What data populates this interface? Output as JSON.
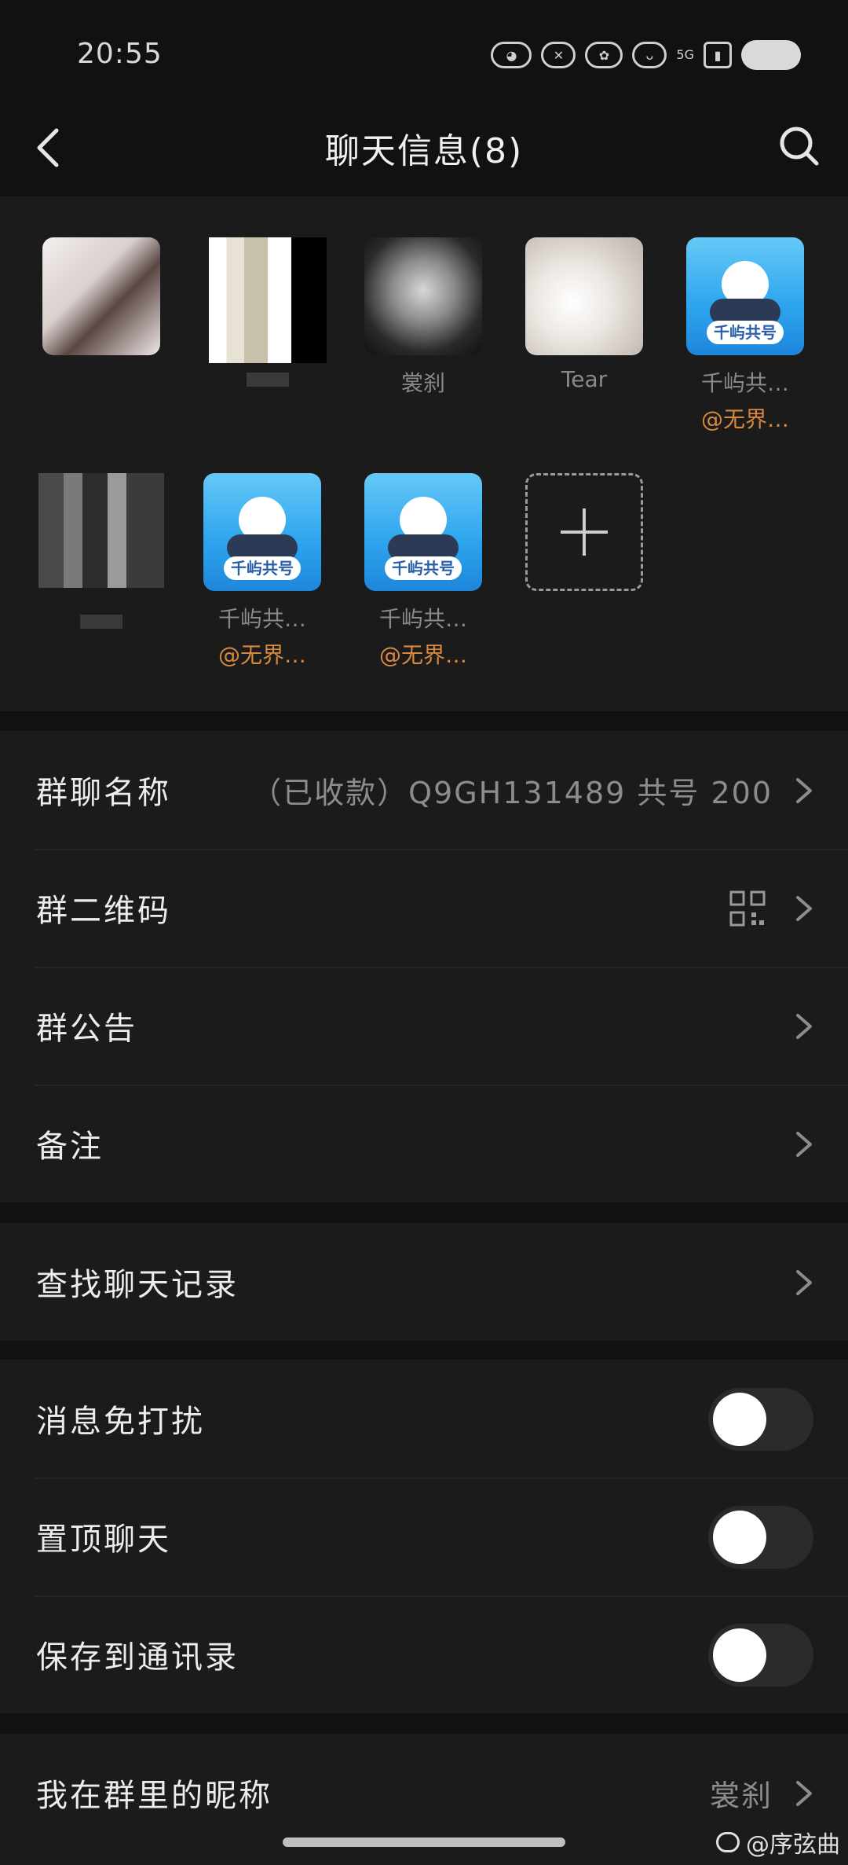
{
  "status_bar": {
    "time": "20:55",
    "network": "5G"
  },
  "header": {
    "title": "聊天信息(8)"
  },
  "members": [
    {
      "name": "",
      "tag": "",
      "avatar": "girl-photo"
    },
    {
      "name": "",
      "tag": "",
      "avatar": "pixelated-photo"
    },
    {
      "name": "裳刹",
      "tag": "",
      "avatar": "ghost-doll"
    },
    {
      "name": "Tear",
      "tag": "",
      "avatar": "white-cat"
    },
    {
      "name": "千屿共…",
      "tag": "@无界…",
      "avatar": "game-mascot"
    },
    {
      "name": "",
      "tag": "",
      "avatar": "pixelated-photo"
    },
    {
      "name": "千屿共…",
      "tag": "@无界…",
      "avatar": "game-mascot"
    },
    {
      "name": "千屿共…",
      "tag": "@无界…",
      "avatar": "game-mascot"
    }
  ],
  "avatar_badge": "千屿共号",
  "settings": {
    "group_name": {
      "label": "群聊名称",
      "value": "（已收款）Q9GH131489 共号 200"
    },
    "group_qr": {
      "label": "群二维码"
    },
    "announcement": {
      "label": "群公告"
    },
    "remark": {
      "label": "备注"
    },
    "search_history": {
      "label": "查找聊天记录"
    },
    "mute": {
      "label": "消息免打扰",
      "on": false
    },
    "pin": {
      "label": "置顶聊天",
      "on": false
    },
    "save_contacts": {
      "label": "保存到通讯录",
      "on": false
    },
    "my_nickname": {
      "label": "我在群里的昵称",
      "value": "裳刹"
    }
  },
  "watermark": "@序弦曲",
  "colors": {
    "background": "#111111",
    "panel": "#1b1b1b",
    "tag": "#d9893e"
  }
}
